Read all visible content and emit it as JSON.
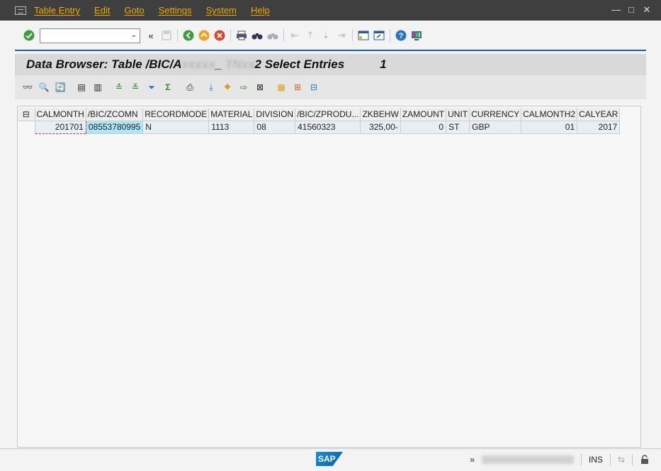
{
  "menu": {
    "items": [
      "Table Entry",
      "Edit",
      "Goto",
      "Settings",
      "System",
      "Help"
    ],
    "window_controls": [
      "—",
      "□",
      "✕"
    ]
  },
  "toolbar": {
    "okcode_value": "",
    "back_glyph": "«"
  },
  "title": {
    "prefix": "Data Browser: Table /BIC/A",
    "redacted_1": "xxxxx",
    "mid": "_",
    "redacted_2": "TNxx",
    "suffix": "2 Select Entries",
    "count": "1"
  },
  "grid": {
    "columns": [
      "CALMONTH",
      "/BIC/ZCOMN",
      "RECORDMODE",
      "MATERIAL",
      "DIVISION",
      "/BIC/ZPRODU...",
      "ZKBEHW",
      "ZAMOUNT",
      "UNIT",
      "CURRENCY",
      "CALMONTH2",
      "CALYEAR"
    ],
    "rows": [
      [
        "201701",
        "08553780995",
        "N",
        "1113",
        "08",
        "41560323",
        "325,00-",
        "0",
        "ST",
        "GBP",
        "01",
        "2017"
      ]
    ]
  },
  "statusbar": {
    "logo": "SAP",
    "expand_glyph": "»",
    "mode": "INS"
  },
  "colors": {
    "menubar_bg": "#3f3f3f",
    "menu_text": "#f0ab00",
    "title_bg": "#d9d9d9",
    "key_cell": "#aee6f7",
    "header_line": "#1f5f9f"
  }
}
